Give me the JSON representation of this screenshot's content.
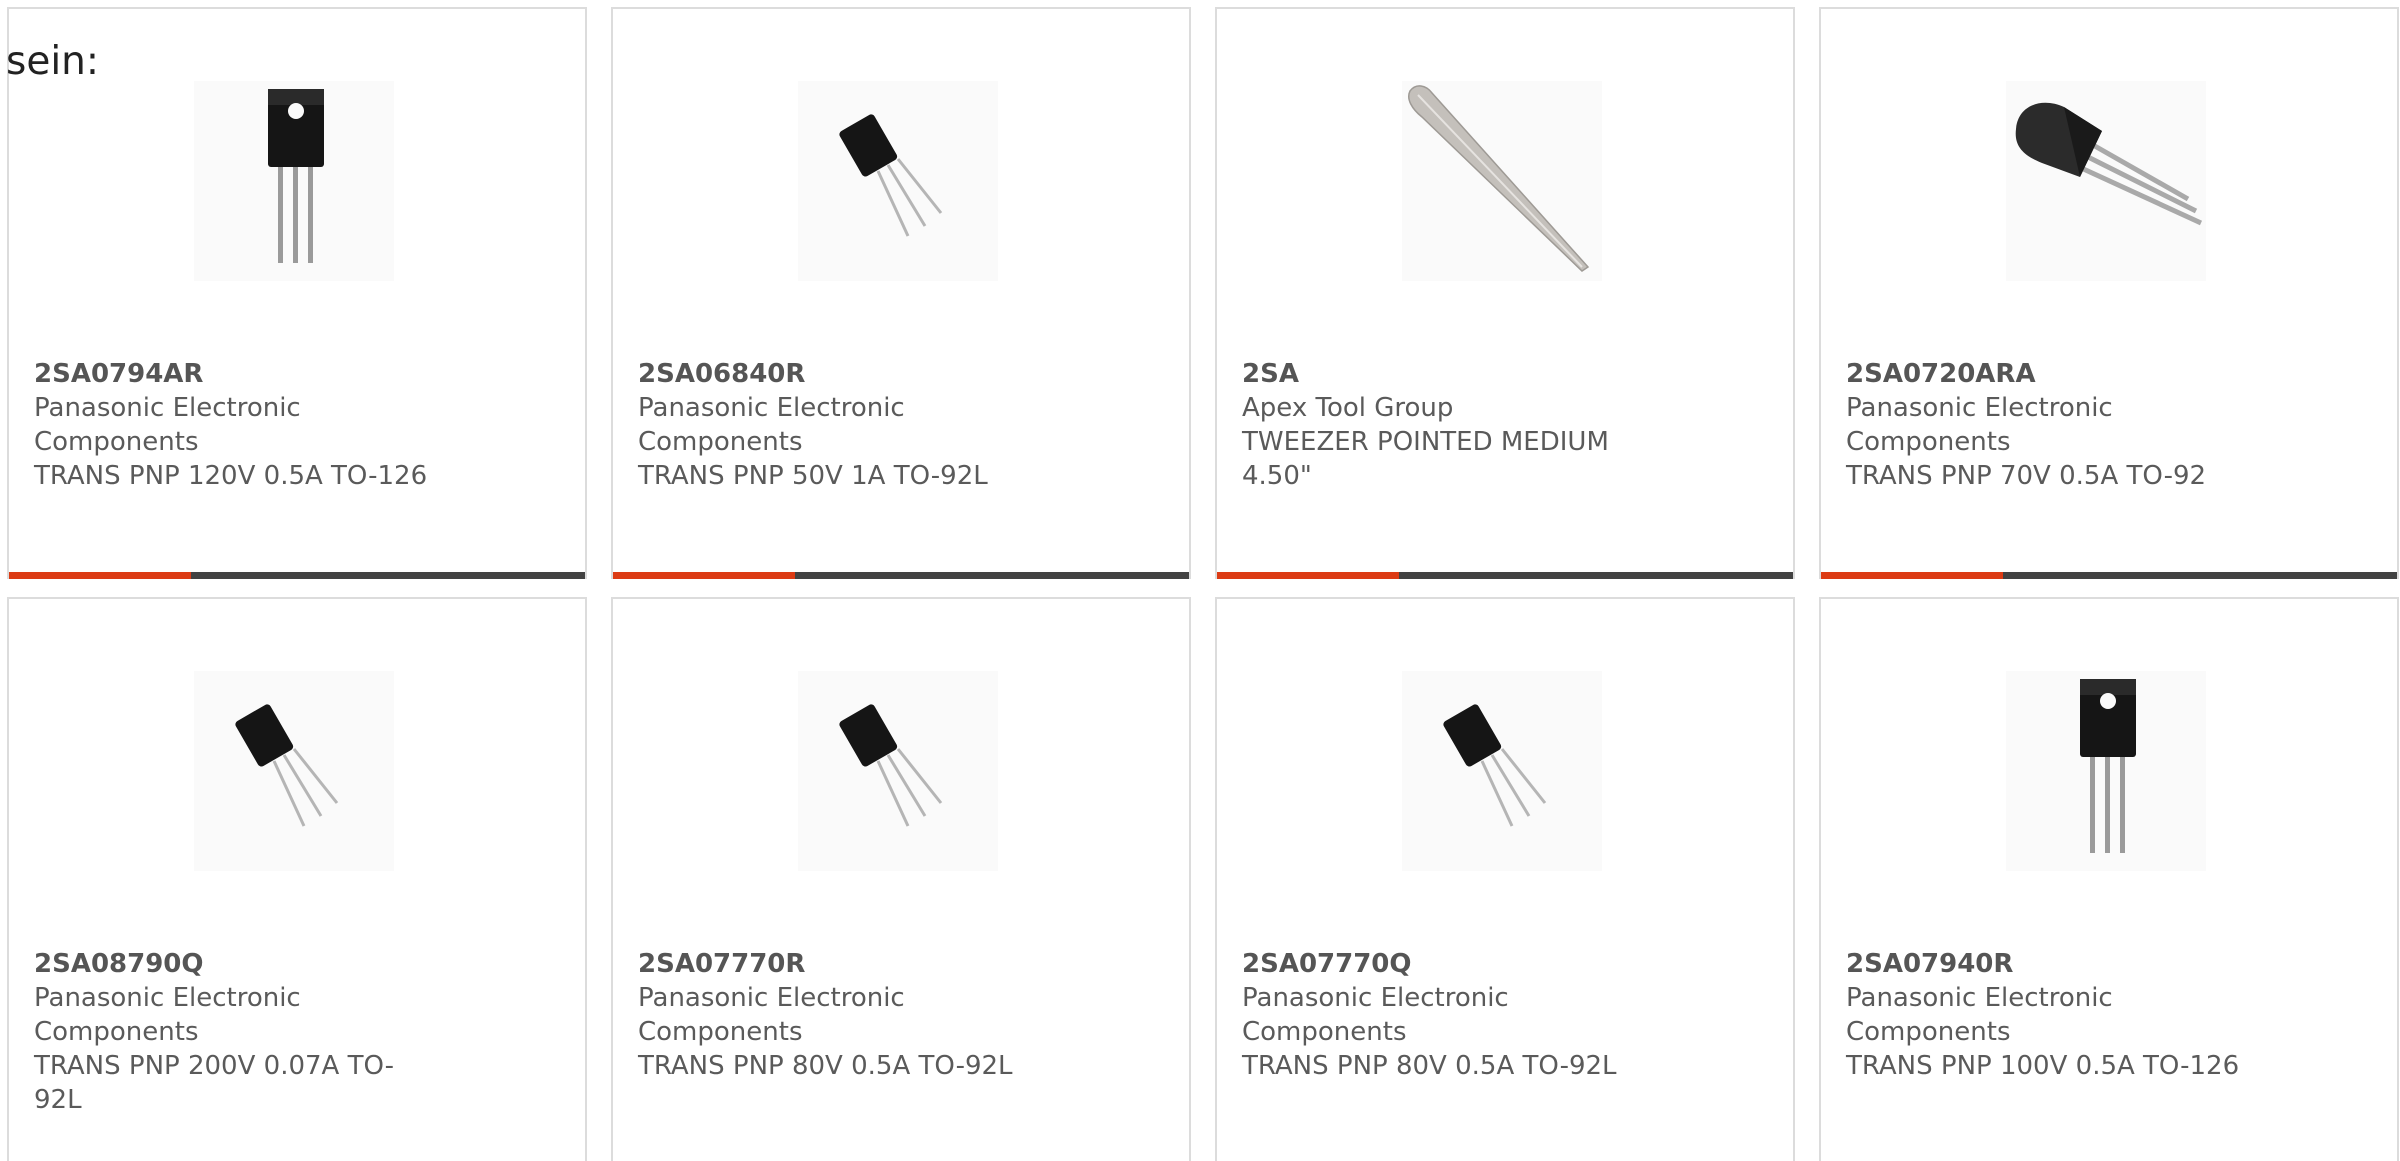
{
  "intro_label": "sein:",
  "colors": {
    "accent": "#dc3b14",
    "bar": "#424242",
    "card_border": "#dcdcdc",
    "text": "#5a5a5a"
  },
  "products": [
    {
      "part_number": "2SA0794AR",
      "manufacturer": "Panasonic Electronic Components",
      "description": "TRANS PNP 120V 0.5A TO-126",
      "image_icon": "to126-transistor-icon"
    },
    {
      "part_number": "2SA06840R",
      "manufacturer": "Panasonic Electronic Components",
      "description": "TRANS PNP 50V 1A TO-92L",
      "image_icon": "to92l-transistor-icon"
    },
    {
      "part_number": "2SA",
      "manufacturer": "Apex Tool Group",
      "description": "TWEEZER POINTED MEDIUM 4.50\"",
      "image_icon": "tweezer-icon"
    },
    {
      "part_number": "2SA0720ARA",
      "manufacturer": "Panasonic Electronic Components",
      "description": "TRANS PNP 70V 0.5A TO-92",
      "image_icon": "to92-transistor-icon"
    },
    {
      "part_number": "2SA08790Q",
      "manufacturer": "Panasonic Electronic Components",
      "description": "TRANS PNP 200V 0.07A TO-92L",
      "image_icon": "to92l-transistor-icon"
    },
    {
      "part_number": "2SA07770R",
      "manufacturer": "Panasonic Electronic Components",
      "description": "TRANS PNP 80V 0.5A TO-92L",
      "image_icon": "to92l-transistor-icon"
    },
    {
      "part_number": "2SA07770Q",
      "manufacturer": "Panasonic Electronic Components",
      "description": "TRANS PNP 80V 0.5A TO-92L",
      "image_icon": "to92l-transistor-icon"
    },
    {
      "part_number": "2SA07940R",
      "manufacturer": "Panasonic Electronic Components",
      "description": "TRANS PNP 100V 0.5A TO-126",
      "image_icon": "to126-transistor-icon"
    }
  ]
}
